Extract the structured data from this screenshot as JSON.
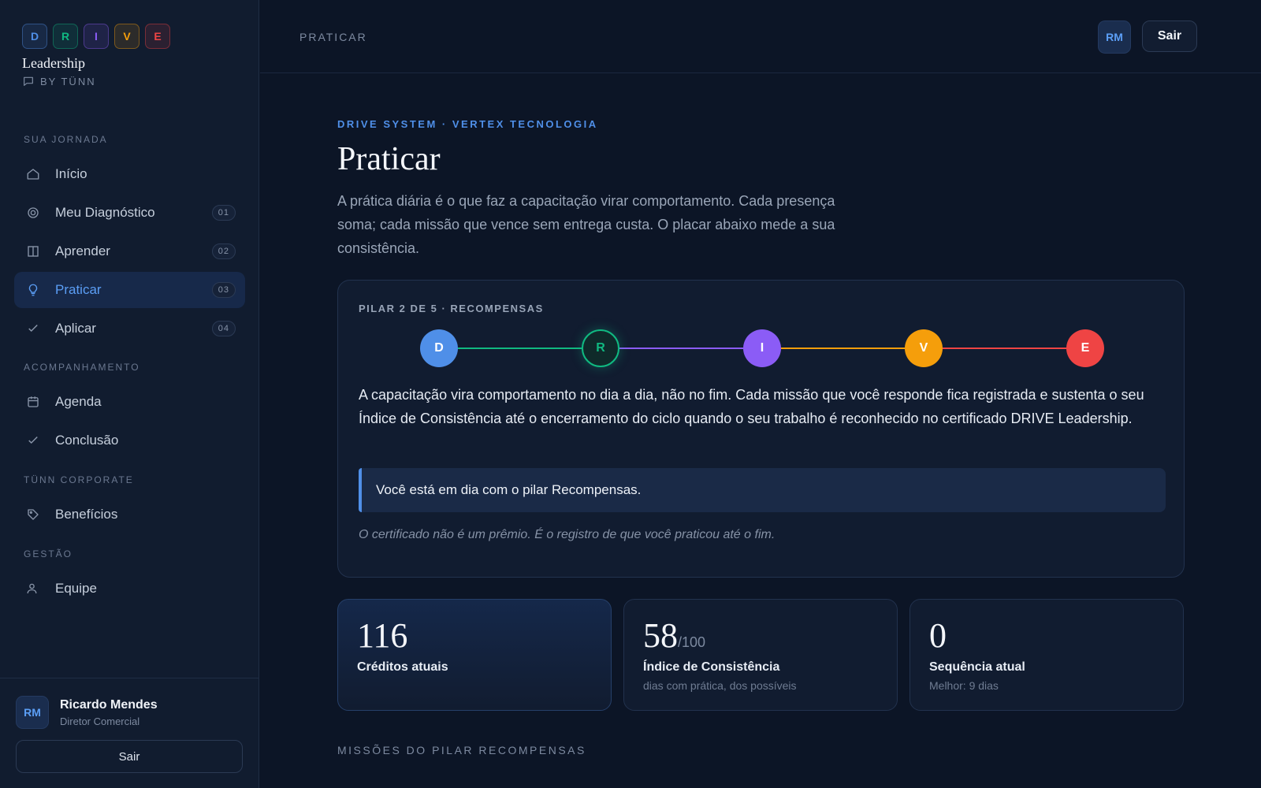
{
  "logo": {
    "letters": [
      {
        "char": "D",
        "color": "#4f8fe8"
      },
      {
        "char": "R",
        "color": "#10b981"
      },
      {
        "char": "I",
        "color": "#8b5cf6"
      },
      {
        "char": "V",
        "color": "#f59e0b"
      },
      {
        "char": "E",
        "color": "#ef4444"
      }
    ],
    "title": "Leadership",
    "subtitle": "BY TÜNN"
  },
  "sidebar": {
    "sections": [
      "SUA JORNADA",
      "ACOMPANHAMENTO",
      "TÜNN CORPORATE",
      "GESTÃO"
    ],
    "items": [
      {
        "label": "Início",
        "icon": "home-icon",
        "badge": ""
      },
      {
        "label": "Meu Diagnóstico",
        "icon": "target-icon",
        "badge": "01"
      },
      {
        "label": "Aprender",
        "icon": "book-icon",
        "badge": "02"
      },
      {
        "label": "Praticar",
        "icon": "lightbulb-icon",
        "badge": "03",
        "active": true
      },
      {
        "label": "Aplicar",
        "icon": "check-icon",
        "badge": "04"
      },
      {
        "label": "Agenda",
        "icon": "calendar-icon",
        "badge": ""
      },
      {
        "label": "Conclusão",
        "icon": "check-icon",
        "badge": ""
      },
      {
        "label": "Benefícios",
        "icon": "tag-icon",
        "badge": ""
      },
      {
        "label": "Equipe",
        "icon": "users-icon",
        "badge": ""
      }
    ]
  },
  "user": {
    "initials": "RM",
    "name": "Ricardo Mendes",
    "role": "Diretor Comercial",
    "logout_label": "Sair"
  },
  "topbar": {
    "breadcrumb": "PRATICAR",
    "initials": "RM",
    "logout_label": "Sair"
  },
  "main": {
    "eyebrow": "DRIVE SYSTEM · VERTEX TECNOLOGIA",
    "title": "Praticar",
    "intro": "A prática diária é o que faz a capacitação virar comportamento. Cada presença soma; cada missão que vence sem entrega custa. O placar abaixo mede a sua consistência.",
    "pillar": {
      "label": "PILAR 2 DE 5 · RECOMPENSAS",
      "steps": [
        {
          "char": "D",
          "color": "#4f8fe8"
        },
        {
          "char": "R",
          "color": "#10b981",
          "current": true
        },
        {
          "char": "I",
          "color": "#8b5cf6"
        },
        {
          "char": "V",
          "color": "#f59e0b"
        },
        {
          "char": "E",
          "color": "#ef4444"
        }
      ],
      "text": "A capacitação vira comportamento no dia a dia, não no fim. Cada missão que você responde fica registrada e sustenta o seu Índice de Consistência até o encerramento do ciclo quando o seu trabalho é reconhecido no certificado DRIVE Leadership.",
      "notice": "Você está em dia com o pilar Recompensas.",
      "footnote": "O certificado não é um prêmio. É o registro de que você praticou até o fim."
    },
    "stats": [
      {
        "value": "116",
        "suffix": "",
        "label": "Créditos atuais",
        "sub": ""
      },
      {
        "value": "58",
        "suffix": "/100",
        "label": "Índice de Consistência",
        "sub": "dias com prática, dos possíveis"
      },
      {
        "value": "0",
        "suffix": "",
        "label": "Sequência atual",
        "sub": "Melhor: 9 dias"
      }
    ],
    "missions_heading": "MISSÕES DO PILAR RECOMPENSAS"
  }
}
